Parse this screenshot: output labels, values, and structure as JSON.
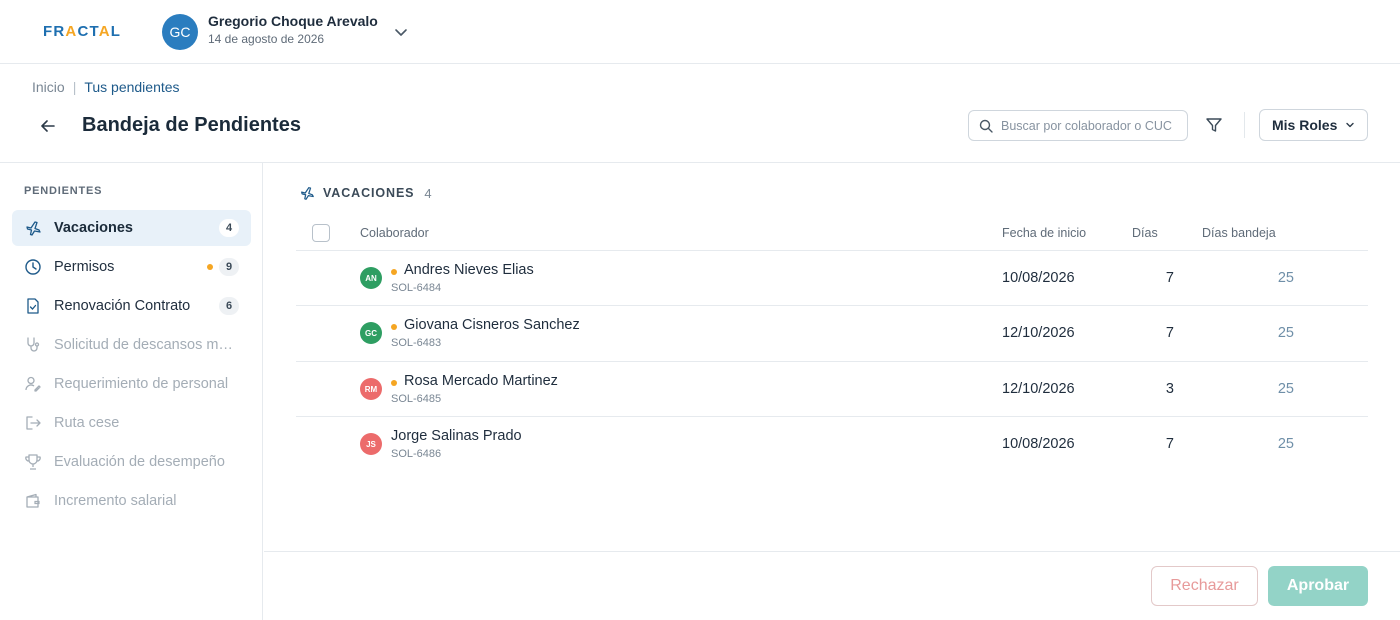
{
  "brand": {
    "logo_left": "FR",
    "logo_a1": "A",
    "logo_mid": "CT",
    "logo_a2": "A",
    "logo_right": "L"
  },
  "user": {
    "initials": "GC",
    "name": "Gregorio Choque Arevalo",
    "date": "14 de agosto de 2026"
  },
  "breadcrumb": {
    "home": "Inicio",
    "separator": "|",
    "current": "Tus pendientes"
  },
  "page": {
    "title": "Bandeja de Pendientes"
  },
  "search": {
    "placeholder": "Buscar por colaborador o CUC",
    "value": ""
  },
  "roles_button": {
    "label": "Mis Roles"
  },
  "sidebar": {
    "heading": "PENDIENTES",
    "items": [
      {
        "label": "Vacaciones",
        "count": "4",
        "icon": "plane-icon",
        "state": "active"
      },
      {
        "label": "Permisos",
        "count": "9",
        "icon": "clock-icon",
        "state": "normal",
        "dot": true
      },
      {
        "label": "Renovación Contrato",
        "count": "6",
        "icon": "file-check-icon",
        "state": "normal"
      },
      {
        "label": "Solicitud de descansos mé…",
        "icon": "stethoscope-icon",
        "state": "disabled"
      },
      {
        "label": "Requerimiento de personal",
        "icon": "user-edit-icon",
        "state": "disabled"
      },
      {
        "label": "Ruta cese",
        "icon": "logout-icon",
        "state": "disabled"
      },
      {
        "label": "Evaluación de desempeño",
        "icon": "trophy-icon",
        "state": "disabled"
      },
      {
        "label": "Incremento salarial",
        "icon": "wallet-icon",
        "state": "disabled"
      }
    ]
  },
  "section": {
    "title": "VACACIONES",
    "count": "4"
  },
  "table": {
    "headers": {
      "collaborator": "Colaborador",
      "start_date": "Fecha de inicio",
      "days": "Días",
      "tray_days": "Días bandeja"
    },
    "rows": [
      {
        "initials": "AN",
        "avatar_color": "#2e9e62",
        "name": "Andres Nieves Elias",
        "code": "SOL-6484",
        "start": "10/08/2026",
        "days": "7",
        "tray": "25",
        "dot": true
      },
      {
        "initials": "GC",
        "avatar_color": "#2e9e62",
        "name": "Giovana Cisneros Sanchez",
        "code": "SOL-6483",
        "start": "12/10/2026",
        "days": "7",
        "tray": "25",
        "dot": true
      },
      {
        "initials": "RM",
        "avatar_color": "#ec6b6b",
        "name": "Rosa Mercado Martinez",
        "code": "SOL-6485",
        "start": "12/10/2026",
        "days": "3",
        "tray": "25",
        "dot": true
      },
      {
        "initials": "JS",
        "avatar_color": "#ec6b6b",
        "name": "Jorge Salinas Prado",
        "code": "SOL-6486",
        "start": "10/08/2026",
        "days": "7",
        "tray": "25",
        "dot": false
      }
    ]
  },
  "actions": {
    "reject": "Rechazar",
    "approve": "Aprobar"
  },
  "colors": {
    "primary": "#1e6fb0",
    "accent_orange": "#f5a623",
    "approve_bg": "#93d3c7",
    "reject_text": "#e79a9a"
  }
}
